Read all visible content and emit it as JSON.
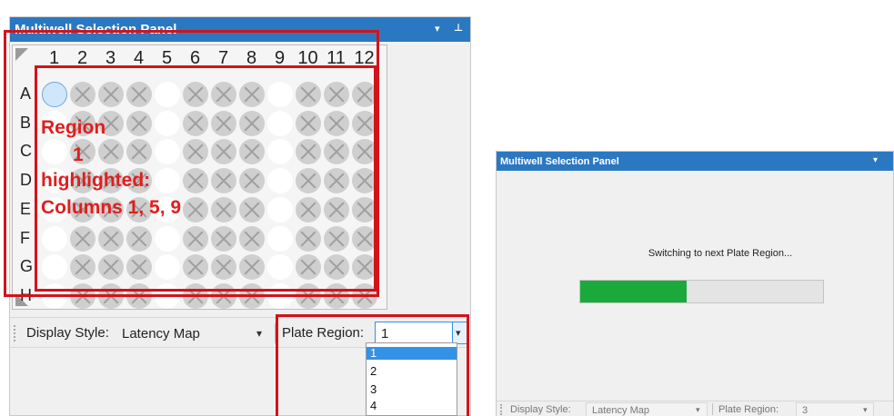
{
  "left_panel": {
    "title": "Multiwell Selection Panel",
    "pin_down_icon": "▾",
    "pin_icon": "⊥",
    "columns": [
      "1",
      "2",
      "3",
      "4",
      "5",
      "6",
      "7",
      "8",
      "9",
      "10",
      "11",
      "12"
    ],
    "rows": [
      "A",
      "B",
      "C",
      "D",
      "E",
      "F",
      "G",
      "H"
    ],
    "selected_columns": [
      1,
      5,
      9
    ],
    "selected_well": "A1",
    "annotation": {
      "line1": "Region",
      "line2": "1",
      "line3": "highlighted:",
      "line4": "Columns 1, 5, 9"
    },
    "toolbar": {
      "display_style_label": "Display Style:",
      "display_style_value": "Latency Map",
      "plate_region_label": "Plate Region:",
      "plate_region_value": "1",
      "dropdown_arrow": "▾"
    },
    "dropdown_options": [
      "1",
      "2",
      "3",
      "4"
    ],
    "dropdown_highlighted": "1"
  },
  "right_panel": {
    "title": "Multiwell Selection Panel",
    "pin_down_icon": "▾",
    "status_text": "Switching to next Plate Region...",
    "progress_fraction": 0.44,
    "toolbar": {
      "display_style_label": "Display Style:",
      "display_style_value": "Latency Map",
      "plate_region_label": "Plate Region:",
      "plate_region_value": "3",
      "dropdown_arrow": "▾"
    }
  },
  "colors": {
    "title_bar": "#2b78c2",
    "highlight_red": "#d3131a",
    "progress_green": "#1aaa3c",
    "selected_option": "#3391e8"
  }
}
